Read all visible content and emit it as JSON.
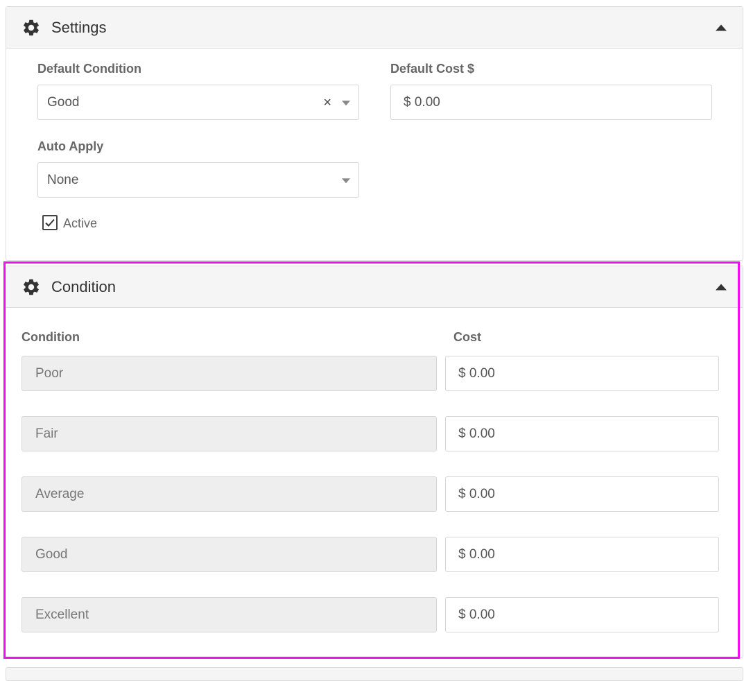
{
  "settings": {
    "title": "Settings",
    "default_condition": {
      "label": "Default Condition",
      "value": "Good",
      "clear_glyph": "×"
    },
    "default_cost": {
      "label": "Default Cost $",
      "value": "$ 0.00"
    },
    "auto_apply": {
      "label": "Auto Apply",
      "value": "None"
    },
    "active": {
      "label": "Active",
      "checked": true
    }
  },
  "condition": {
    "title": "Condition",
    "headers": {
      "condition": "Condition",
      "cost": "Cost"
    },
    "rows": [
      {
        "name": "Poor",
        "cost": "$ 0.00"
      },
      {
        "name": "Fair",
        "cost": "$ 0.00"
      },
      {
        "name": "Average",
        "cost": "$ 0.00"
      },
      {
        "name": "Good",
        "cost": "$ 0.00"
      },
      {
        "name": "Excellent",
        "cost": "$ 0.00"
      }
    ]
  },
  "icons": {
    "panel": "gear-icon",
    "collapse": "caret-up-icon",
    "check": "check-icon"
  },
  "colors": {
    "highlight": "#ee11ee",
    "header_bg": "#f5f5f5",
    "disabled_bg": "#eeeeee"
  }
}
